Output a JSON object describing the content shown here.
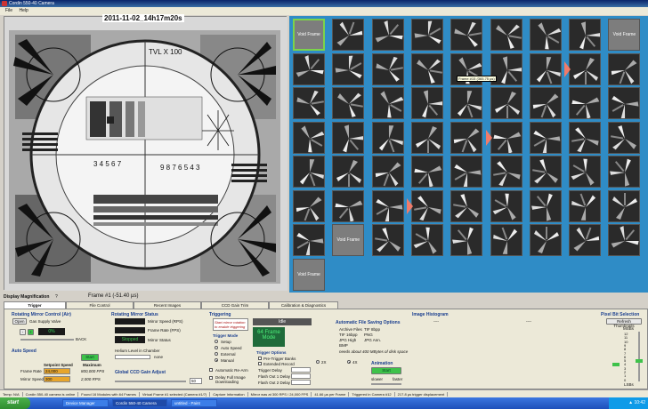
{
  "window": {
    "title": "Cordin 550-40 Camera"
  },
  "menu": {
    "items": [
      "File",
      "Help"
    ]
  },
  "viewer": {
    "timestamp": "2011-11-02_14h17m20s",
    "chart_label": "TVL X 100",
    "scale_top": "3 4 5 6 7",
    "scale_bottom": "9 8 7 6 5 4 3"
  },
  "grid": {
    "void_label": "Void Frame",
    "tooltip": "Frame #15 (365.75 µs)",
    "accent": "#2f8cc6",
    "selected_color": "#7cd34a",
    "marker_color": "#f07b6a"
  },
  "status": {
    "magnification_label": "Display Magnification",
    "magnification_value": "?",
    "frame": "Frame #1 (-51.40 µs)"
  },
  "tabs": [
    "Trigger",
    "File Control",
    "Recent Images",
    "CCD Gain Trim",
    "Calibration & Diagnostics"
  ],
  "mirror": {
    "title": "Rotating Mirror Control (Air)",
    "open_label": "Open",
    "gas_label": "Gas Supply Valve",
    "pct": "0%",
    "gauge_label": "BACK",
    "auto_speed_title": "Auto Speed",
    "start_label": "Start",
    "setpoint_label": "Setpoint Speed",
    "maximum_label": "Maximum",
    "frame_rate_label": "Frame Rate",
    "frame_rate_set": "24,000",
    "frame_rate_max": "800,000 FPS",
    "mirror_speed_label": "Mirror Speed",
    "mirror_speed_set": "300",
    "mirror_speed_max": "2,000 RPS"
  },
  "mirror_status": {
    "title": "Rotating Mirror Status",
    "speed_label": "Mirror Speed (RPS)",
    "rate_label": "Frame Rate (FPS)",
    "status_value": "Stopped",
    "status_label": "Mirror Status",
    "helium_label": "Helium Level in Chamber",
    "helium_unit": "none",
    "gain_title": "Global CCD Gain Adjust",
    "gain_value": "50"
  },
  "trigger": {
    "title": "Triggering",
    "hint": "Start mirror rotation to enable triggering",
    "mode_title": "Trigger Mode",
    "modes": [
      "Setup",
      "Auto Speed",
      "External",
      "Manual"
    ],
    "idle": "Idle",
    "frame_mode_1": "64 Frame",
    "frame_mode_2": "Mode",
    "auto_rearm": "Automatic Re-Arm",
    "delay_full": "Delay Full Image Downloading",
    "options_title": "Trigger Options",
    "pretrigger": "Pre-Trigger Banks",
    "extended": "Extended Record",
    "x2": "2X",
    "x4": "4X",
    "trigger_delay": "Trigger Delay",
    "flash1": "Flash Out 1 Delay",
    "flash2": "Flash Out 2 Delay"
  },
  "filesave": {
    "title": "Automatic File Saving Options",
    "archive": "Archive Files",
    "tif16": "TIF 16bpp",
    "tif8": "TIF 8bpp",
    "jpg_high": "JPG High",
    "bmp": "BMP",
    "png": "PNG",
    "jpg_ann": "JPG Ann.",
    "needs": "needs about 400 MBytes of disk space",
    "anim_title": "Animation",
    "anim_start": "Start",
    "slower": "slower",
    "faster": "faster"
  },
  "histogram": {
    "title": "Image Histogram",
    "left": "----",
    "right": "----"
  },
  "pixelbit": {
    "title": "Pixel Bit Selection",
    "refresh": "Refresh Thumbnails",
    "msbs": "MSBs",
    "lsbs": "LSBs",
    "bits": [
      "12",
      "11",
      "10",
      "9",
      "8",
      "7",
      "6",
      "5",
      "4",
      "3",
      "2",
      "1",
      "0"
    ]
  },
  "statusbar": [
    "Temp: N/A",
    "Cordin 550-40 camera is online",
    "Found 16 Modules with 64 Frames",
    "Virtual Frame #1 selected (Camera #1/7)",
    "Capture Information",
    "Mirror was at 300 RPS / 24,000 FPS",
    "41.66 µs per Frame",
    "Triggered in Camera #12",
    "217.8 µs trigger displacement"
  ],
  "taskbar": {
    "start": "start",
    "tasks": [
      "Device Manager",
      "Cordin 550-40 Camera",
      "untitled - Paint"
    ],
    "clock": "▲ 10:42"
  }
}
